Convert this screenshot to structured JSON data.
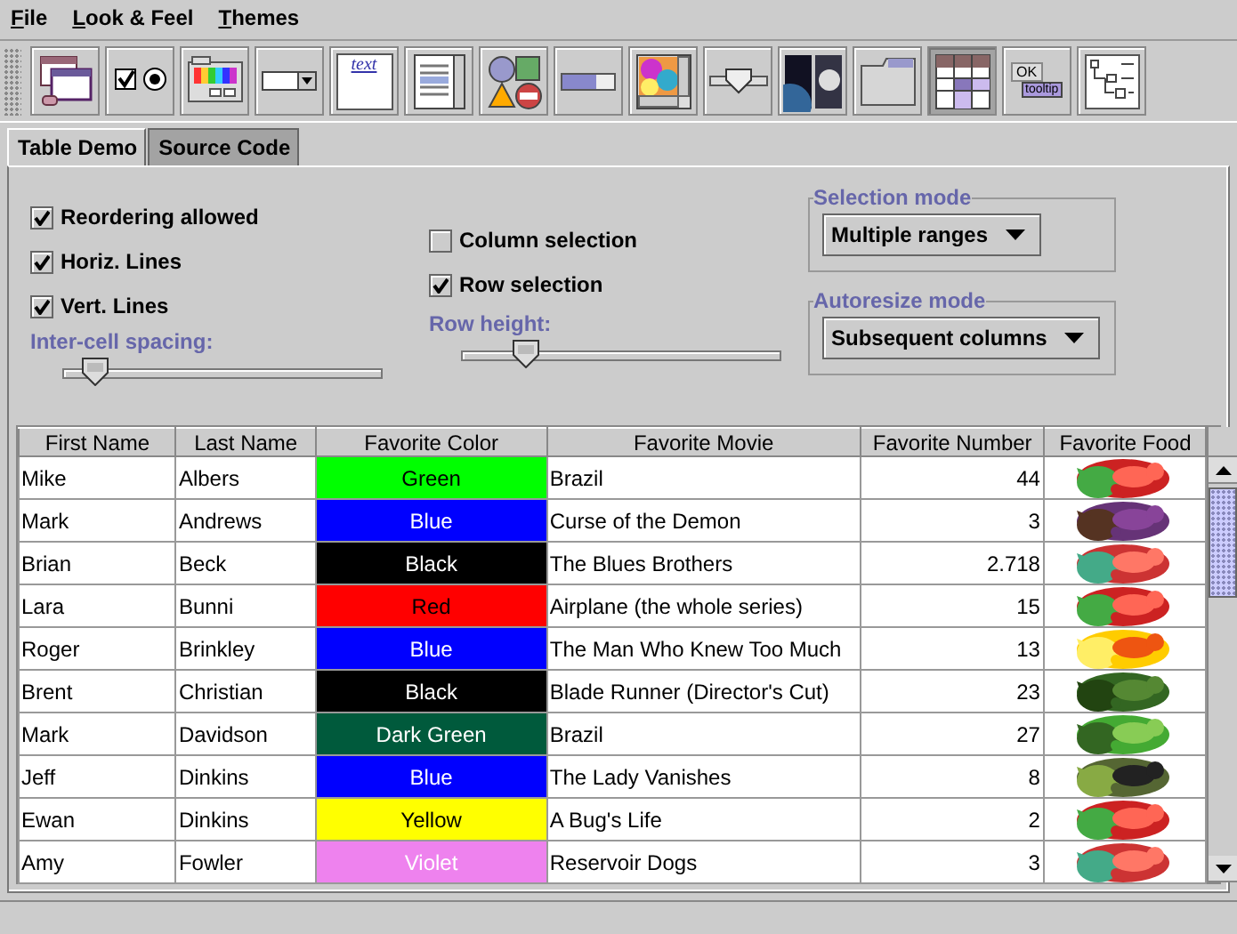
{
  "menu": [
    "File",
    "Look & Feel",
    "Themes"
  ],
  "toolbar": [
    {
      "kind": "frames",
      "selected": false
    },
    {
      "kind": "buttons",
      "selected": false
    },
    {
      "kind": "colorchooser",
      "selected": false
    },
    {
      "kind": "combobox",
      "selected": false
    },
    {
      "kind": "editor",
      "selected": false,
      "label": "text"
    },
    {
      "kind": "list",
      "selected": false
    },
    {
      "kind": "optionpane",
      "selected": false
    },
    {
      "kind": "progress",
      "selected": false
    },
    {
      "kind": "scrollpane",
      "selected": false
    },
    {
      "kind": "slider",
      "selected": false
    },
    {
      "kind": "splitpane",
      "selected": false
    },
    {
      "kind": "tabbedpane",
      "selected": false
    },
    {
      "kind": "table",
      "selected": true
    },
    {
      "kind": "tooltip",
      "selected": false,
      "label": "OK",
      "tip": "tooltip"
    },
    {
      "kind": "tree",
      "selected": false
    }
  ],
  "tabs": [
    {
      "label": "Table Demo",
      "selected": true
    },
    {
      "label": "Source Code",
      "selected": false
    }
  ],
  "options": {
    "left": [
      {
        "label": "Reordering allowed",
        "checked": true
      },
      {
        "label": "Horiz. Lines",
        "checked": true
      },
      {
        "label": "Vert. Lines",
        "checked": true
      }
    ],
    "spacing": {
      "label": "Inter-cell spacing:",
      "level": 0.1
    },
    "middle": [
      {
        "label": "Column selection",
        "checked": false
      },
      {
        "label": "Row selection",
        "checked": true
      }
    ],
    "row_height": {
      "label": "Row height:",
      "level": 0.2
    },
    "selection_mode": {
      "title": "Selection mode",
      "value": "Multiple ranges"
    },
    "autoresize_mode": {
      "title": "Autoresize mode",
      "value": "Subsequent columns"
    }
  },
  "table": {
    "columns": [
      "First Name",
      "Last Name",
      "Favorite Color",
      "Favorite Movie",
      "Favorite Number",
      "Favorite Food"
    ],
    "rows": [
      {
        "first": "Mike",
        "last": "Albers",
        "color_name": "Green",
        "color": "#00ff00",
        "light_text": false,
        "movie": "Brazil",
        "number": "44"
      },
      {
        "first": "Mark",
        "last": "Andrews",
        "color_name": "Blue",
        "color": "#0000ff",
        "light_text": true,
        "movie": "Curse of the Demon",
        "number": "3"
      },
      {
        "first": "Brian",
        "last": "Beck",
        "color_name": "Black",
        "color": "#000000",
        "light_text": true,
        "movie": "The Blues Brothers",
        "number": "2.718"
      },
      {
        "first": "Lara",
        "last": "Bunni",
        "color_name": "Red",
        "color": "#ff0000",
        "light_text": false,
        "movie": "Airplane (the whole series)",
        "number": "15"
      },
      {
        "first": "Roger",
        "last": "Brinkley",
        "color_name": "Blue",
        "color": "#0000ff",
        "light_text": true,
        "movie": "The Man Who Knew Too Much",
        "number": "13"
      },
      {
        "first": "Brent",
        "last": "Christian",
        "color_name": "Black",
        "color": "#000000",
        "light_text": true,
        "movie": "Blade Runner (Director's Cut)",
        "number": "23"
      },
      {
        "first": "Mark",
        "last": "Davidson",
        "color_name": "Dark Green",
        "color": "#005a3c",
        "light_text": true,
        "movie": "Brazil",
        "number": "27"
      },
      {
        "first": "Jeff",
        "last": "Dinkins",
        "color_name": "Blue",
        "color": "#0000ff",
        "light_text": true,
        "movie": "The Lady Vanishes",
        "number": "8"
      },
      {
        "first": "Ewan",
        "last": "Dinkins",
        "color_name": "Yellow",
        "color": "#ffff00",
        "light_text": false,
        "movie": "A Bug's Life",
        "number": "2"
      },
      {
        "first": "Amy",
        "last": "Fowler",
        "color_name": "Violet",
        "color": "#ee82ee",
        "light_text": true,
        "movie": "Reservoir Dogs",
        "number": "3"
      }
    ]
  }
}
